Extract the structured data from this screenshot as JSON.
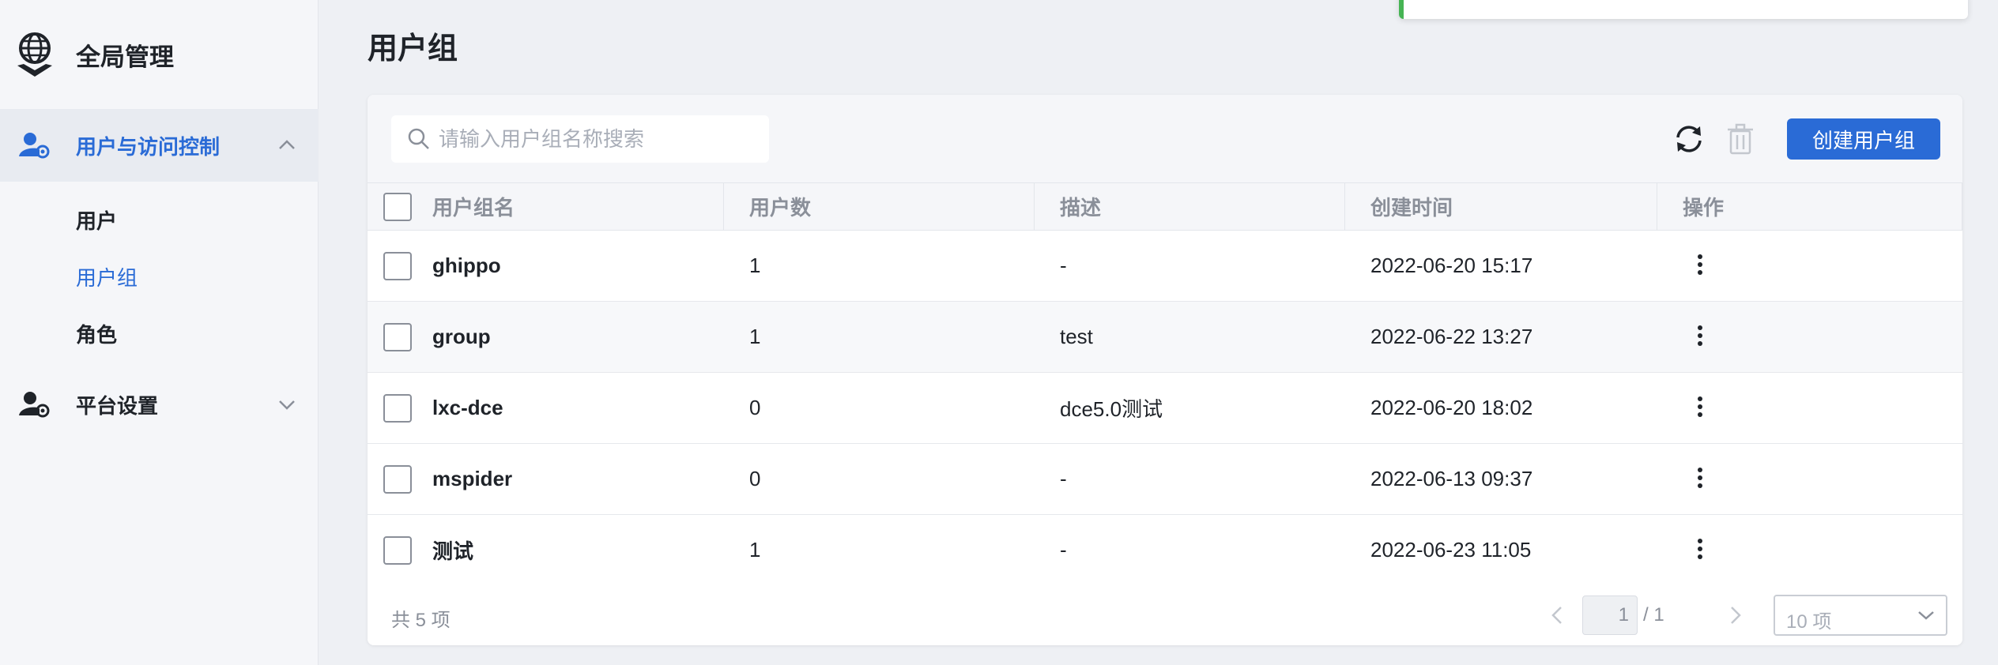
{
  "app": {
    "title": "全局管理",
    "brand_icon": "globe-hand-icon"
  },
  "sidebar": {
    "groups": [
      {
        "label": "用户与访问控制",
        "icon": "user-gear-icon",
        "expanded": true,
        "active": true
      },
      {
        "label": "平台设置",
        "icon": "user-gear-icon",
        "expanded": false,
        "active": false
      }
    ],
    "subitems": [
      {
        "label": "用户",
        "active": false
      },
      {
        "label": "用户组",
        "active": true
      },
      {
        "label": "角色",
        "active": false
      }
    ]
  },
  "page": {
    "title": "用户组"
  },
  "toolbar": {
    "search_placeholder": "请输入用户组名称搜索",
    "refresh_icon": "refresh-icon",
    "delete_icon": "trash-icon",
    "create_label": "创建用户组"
  },
  "table": {
    "headers": [
      "用户组名",
      "用户数",
      "描述",
      "创建时间",
      "操作"
    ],
    "rows": [
      {
        "name": "ghippo",
        "users": "1",
        "desc": "-",
        "created": "2022-06-20 15:17"
      },
      {
        "name": "group",
        "users": "1",
        "desc": "test",
        "created": "2022-06-22 13:27"
      },
      {
        "name": "lxc-dce",
        "users": "0",
        "desc": "dce5.0测试",
        "created": "2022-06-20 18:02"
      },
      {
        "name": "mspider",
        "users": "0",
        "desc": "-",
        "created": "2022-06-13 09:37"
      },
      {
        "name": "测试",
        "users": "1",
        "desc": "-",
        "created": "2022-06-23 11:05"
      }
    ]
  },
  "pagination": {
    "total": "共 5 项",
    "current": "1",
    "of_total": "/ 1",
    "page_size": "10 项"
  },
  "colors": {
    "accent": "#2a6bd6",
    "success": "#46b454",
    "sidebar_bg": "#f5f6f9",
    "page_bg": "#eef0f4"
  }
}
